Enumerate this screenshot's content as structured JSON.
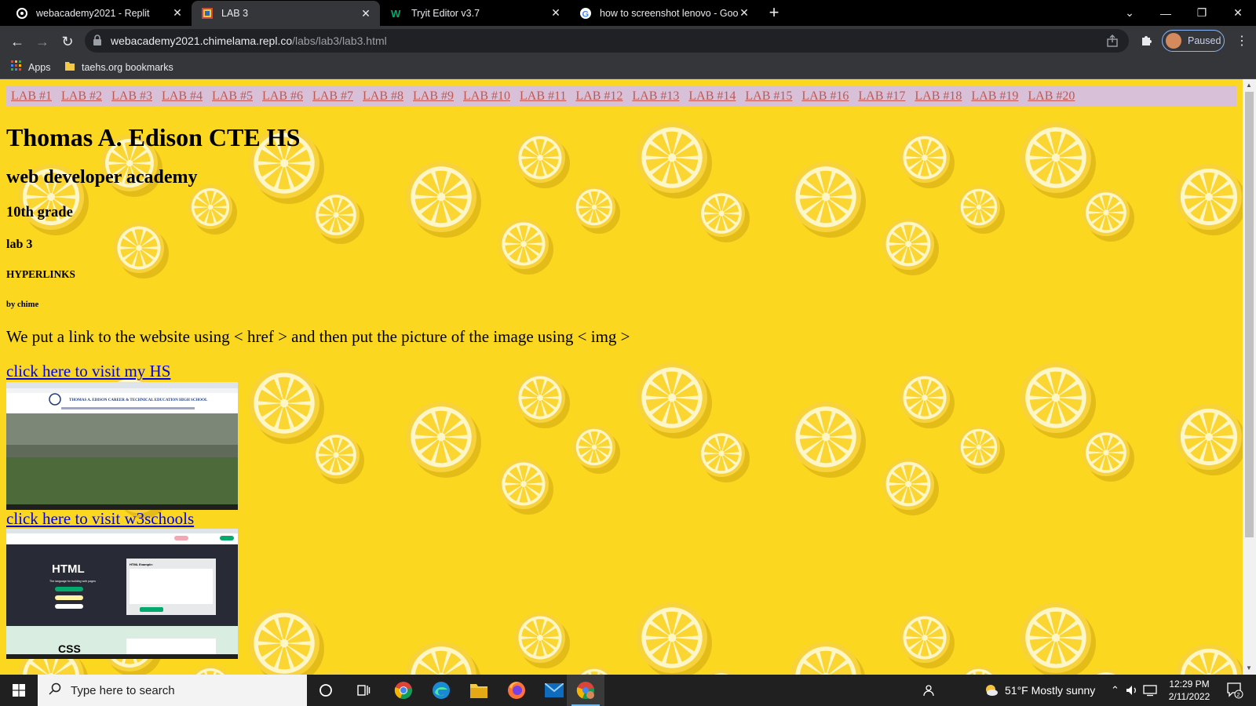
{
  "browser": {
    "tabs": [
      {
        "title": "webacademy2021 - Replit",
        "icon": "replit-icon",
        "active": false
      },
      {
        "title": "LAB 3",
        "icon": "page-favicon-icon",
        "active": true
      },
      {
        "title": "Tryit Editor v3.7",
        "icon": "w3schools-icon",
        "active": false
      },
      {
        "title": "how to screenshot lenovo - Goog",
        "icon": "google-icon",
        "active": false
      }
    ],
    "url_host": "webacademy2021.chimelama.repl.co",
    "url_path": "/labs/lab3/lab3.html",
    "profile_label": "Paused",
    "bookmarks": [
      {
        "label": "Apps",
        "icon": "apps-grid-icon"
      },
      {
        "label": "taehs.org bookmarks",
        "icon": "folder-icon"
      }
    ]
  },
  "page": {
    "nav_links": [
      "LAB #1",
      "LAB #2",
      "LAB #3",
      "LAB #4",
      "LAB #5",
      "LAB #6",
      "LAB #7",
      "LAB #8",
      "LAB #9",
      "LAB #10",
      "LAB #11",
      "LAB #12",
      "LAB #13",
      "LAB #14",
      "LAB #15",
      "LAB #16",
      "LAB #17",
      "LAB #18",
      "LAB #19",
      "LAB #20"
    ],
    "h1": "Thomas A. Edison CTE HS",
    "h2": "web developer academy",
    "h3": "10th grade",
    "h4": "lab 3",
    "h5": "HYPERLINKS",
    "h6": "by chime",
    "paragraph": "We put a link to the website using < href > and then put the picture of the image using < img >",
    "link1": "click here to visit my HS",
    "link2": "click here to visit w3schools",
    "thumb1_banner": "THOMAS A. EDISON CAREER & TECHNICAL EDUCATION HIGH SCHOOL",
    "thumb2_html": "HTML",
    "thumb2_css": "CSS",
    "thumb2_example": "HTML Example:",
    "thumb2_sub": "The language for building web pages"
  },
  "taskbar": {
    "search_placeholder": "Type here to search",
    "weather": "51°F  Mostly sunny",
    "time": "12:29 PM",
    "date": "2/11/2022",
    "notifications": "2"
  },
  "colors": {
    "page_bg": "#fbd720",
    "nav_bg": "#d8c0d8",
    "nav_link": "#c0584f",
    "link": "#0000ee"
  }
}
